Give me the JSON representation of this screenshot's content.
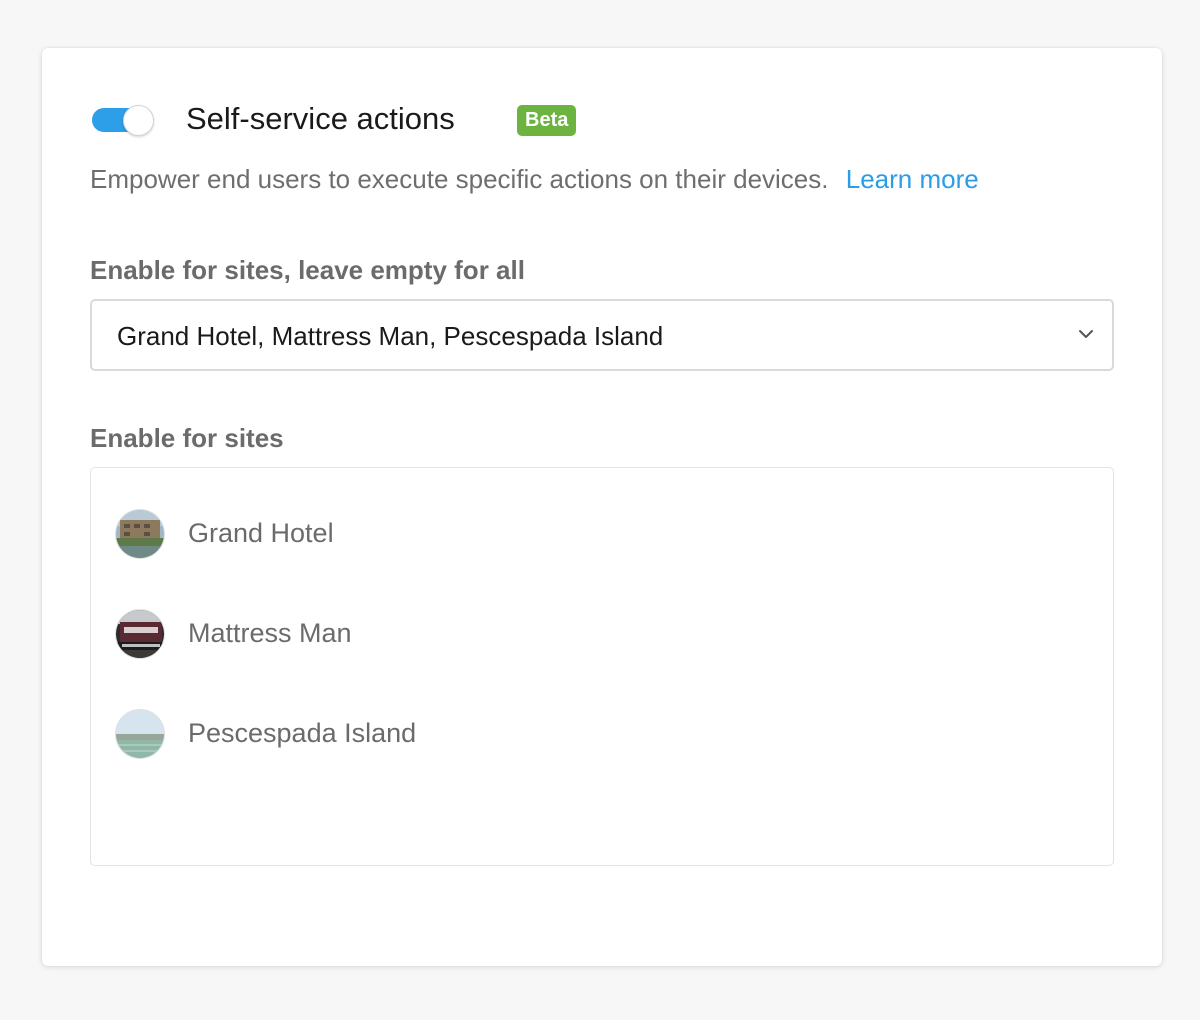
{
  "section": {
    "toggle_on": true,
    "title": "Self-service actions",
    "badge": "Beta",
    "description": "Empower end users to execute specific actions on their devices.",
    "learn_more": "Learn more"
  },
  "site_filter": {
    "label": "Enable for sites, leave empty for all",
    "selected_value": "Grand Hotel, Mattress Man, Pescespada Island"
  },
  "site_list": {
    "label": "Enable for sites",
    "items": [
      {
        "name": "Grand Hotel"
      },
      {
        "name": "Mattress Man"
      },
      {
        "name": "Pescespada Island"
      }
    ]
  },
  "colors": {
    "toggle_on": "#2d9ee8",
    "badge": "#6db33f",
    "link": "#2a9de6"
  },
  "icons": {
    "dropdown": "chevron-down-icon"
  }
}
